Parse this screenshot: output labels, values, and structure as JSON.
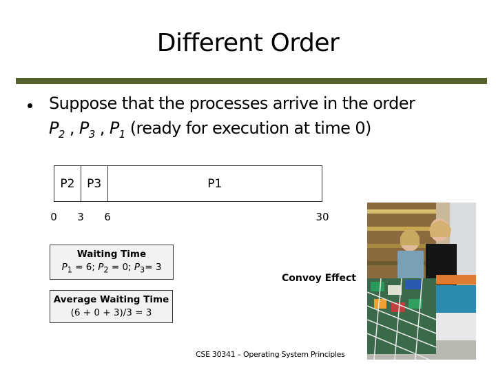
{
  "slide": {
    "title": "Different Order",
    "bullet": {
      "line1": "Suppose that the processes arrive in the order",
      "order": [
        {
          "name": "P",
          "sub": "2"
        },
        {
          "name": "P",
          "sub": "3"
        },
        {
          "name": "P",
          "sub": "1"
        }
      ],
      "separator": " , ",
      "line2_suffix": " (ready for execution at time 0)"
    },
    "gantt": {
      "segments": [
        {
          "label": "P2",
          "start": 0,
          "end": 3
        },
        {
          "label": "P3",
          "start": 3,
          "end": 6
        },
        {
          "label": "P1",
          "start": 6,
          "end": 30
        }
      ],
      "ticks": [
        "0",
        "3",
        "6",
        "30"
      ],
      "total": 30
    },
    "waiting_box": {
      "header": "Waiting Time",
      "items": [
        {
          "name": "P",
          "sub": "1",
          "value": " = 6; "
        },
        {
          "name": "P",
          "sub": "2",
          "value": " = 0; "
        },
        {
          "name": "P",
          "sub": "3",
          "value": "= 3"
        }
      ]
    },
    "average_box": {
      "header": "Average Waiting Time",
      "formula": "(6 + 0 + 3)/3 = 3"
    },
    "convoy_label": "Convoy Effect",
    "footer": "CSE 30341 – Operating System Principles",
    "photo": {
      "description": "shoppers-with-full-carts-photo"
    },
    "colors": {
      "rule": "#53622d",
      "box_fill": "#f2f2f2"
    }
  }
}
